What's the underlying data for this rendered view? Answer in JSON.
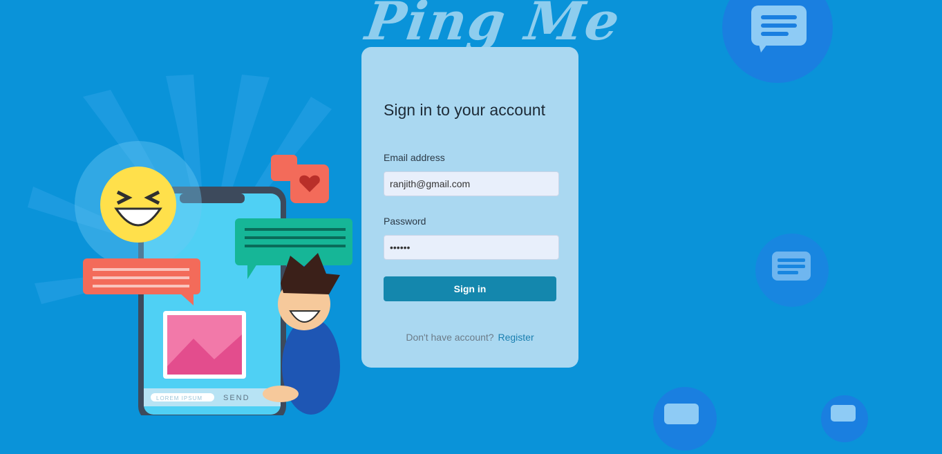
{
  "brand": {
    "logo_text": "Ping Me"
  },
  "signin": {
    "title": "Sign in to your account",
    "email_label": "Email address",
    "email_value": "ranjith@gmail.com",
    "password_label": "Password",
    "password_value": "••••••",
    "submit_label": "Sign in",
    "no_account_text": "Don't have account?",
    "register_link": "Register"
  },
  "illustration": {
    "phone_input_placeholder": "LOREM IPSUM",
    "phone_send_label": "SEND"
  }
}
